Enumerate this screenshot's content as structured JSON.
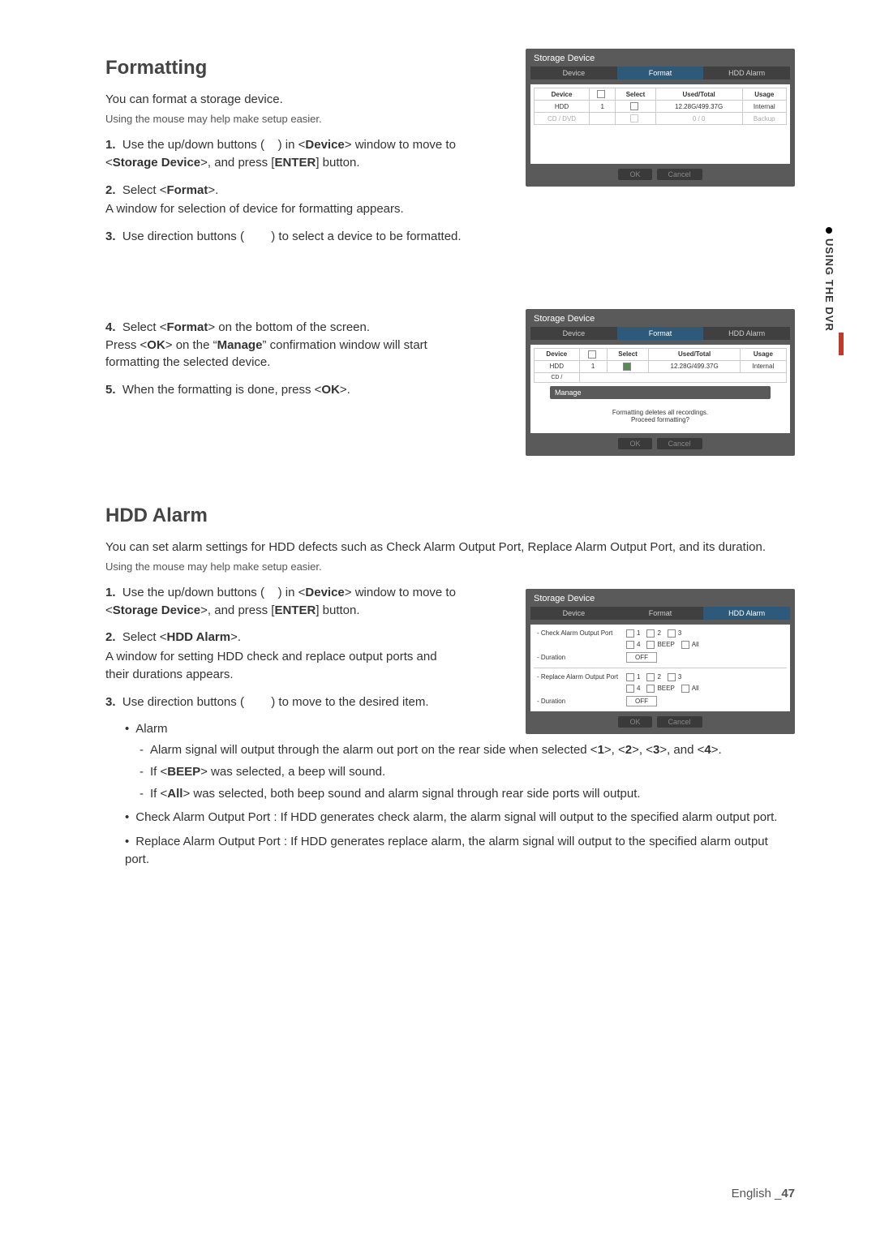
{
  "sideTab": "USING THE DVR",
  "sec1": {
    "title": "Formatting",
    "intro": "You can format a storage device.",
    "tip": "Using the mouse may help make setup easier.",
    "s1a": "Use the up/down buttons (    ) in <",
    "s1b": "Device",
    "s1c": "> window to move to <",
    "s1d": "Storage Device",
    "s1e": ">, and press [",
    "s1f": "ENTER",
    "s1g": "] button.",
    "s2a": "Select <",
    "s2b": "Format",
    "s2c": ">.",
    "s2d": "A window for selection of device for formatting appears.",
    "s3": "Use direction buttons (        ) to select a device to be formatted.",
    "s4a": "Select <",
    "s4b": "Format",
    "s4c": "> on the bottom of the screen.",
    "s4d": "Press <",
    "s4e": "OK",
    "s4f": "> on the “",
    "s4g": "Manage",
    "s4h": "” confirmation window will start formatting the selected device.",
    "s5a": "When the formatting is done, press <",
    "s5b": "OK",
    "s5c": ">."
  },
  "sec2": {
    "title": "HDD Alarm",
    "intro": "You can set alarm settings for HDD defects such as Check Alarm Output Port, Replace Alarm Output Port, and its duration.",
    "tip": "Using the mouse may help make setup easier.",
    "s1a": "Use the up/down buttons (    ) in <",
    "s1b": "Device",
    "s1c": "> window to move to <",
    "s1d": "Storage Device",
    "s1e": ">, and press [",
    "s1f": "ENTER",
    "s1g": "] button.",
    "s2a": "Select <",
    "s2b": "HDD Alarm",
    "s2c": ">.",
    "s2d": "A window for setting HDD check and replace output ports and their durations appears.",
    "s3": "Use direction buttons (        ) to move to the desired item.",
    "b_alarm": "Alarm",
    "d1a": "Alarm signal will output through the alarm out port on the rear side when selected <",
    "d1b": "1",
    "d1c": ">, <",
    "d1d": "2",
    "d1e": ">, <",
    "d1f": "3",
    "d1g": ">, and <",
    "d1h": "4",
    "d1i": ">.",
    "d2a": "If <",
    "d2b": "BEEP",
    "d2c": "> was selected, a beep will sound.",
    "d3a": "If <",
    "d3b": "All",
    "d3c": "> was selected, both beep sound and alarm signal through rear side ports will output.",
    "b_check": "Check Alarm Output Port : If HDD generates check alarm, the alarm signal will output to the specified alarm output port.",
    "b_replace": "Replace Alarm Output Port : If HDD generates replace alarm, the alarm signal will output to the specified alarm output port."
  },
  "shot": {
    "title": "Storage Device",
    "tabs": [
      "Device",
      "Format",
      "HDD Alarm"
    ],
    "th": [
      "Device",
      "",
      "Select",
      "Used/Total",
      "Usage"
    ],
    "r1": [
      "HDD",
      "1",
      "",
      "12.28G/499.37G",
      "Internal"
    ],
    "r2": [
      "CD / DVD",
      "",
      "",
      "0 / 0",
      "Backup"
    ],
    "manage": "Manage",
    "msg1": "Formatting deletes all recordings.",
    "msg2": "Proceed formatting?",
    "ok": "OK",
    "cancel": "Cancel",
    "lab_check": "- Check Alarm Output Port",
    "lab_replace": "- Replace Alarm Output Port",
    "lab_dur": "- Duration",
    "opt": [
      "1",
      "2",
      "3",
      "4",
      "BEEP",
      "All"
    ],
    "off": "OFF"
  },
  "footer": {
    "lang": "English _",
    "page": "47"
  }
}
